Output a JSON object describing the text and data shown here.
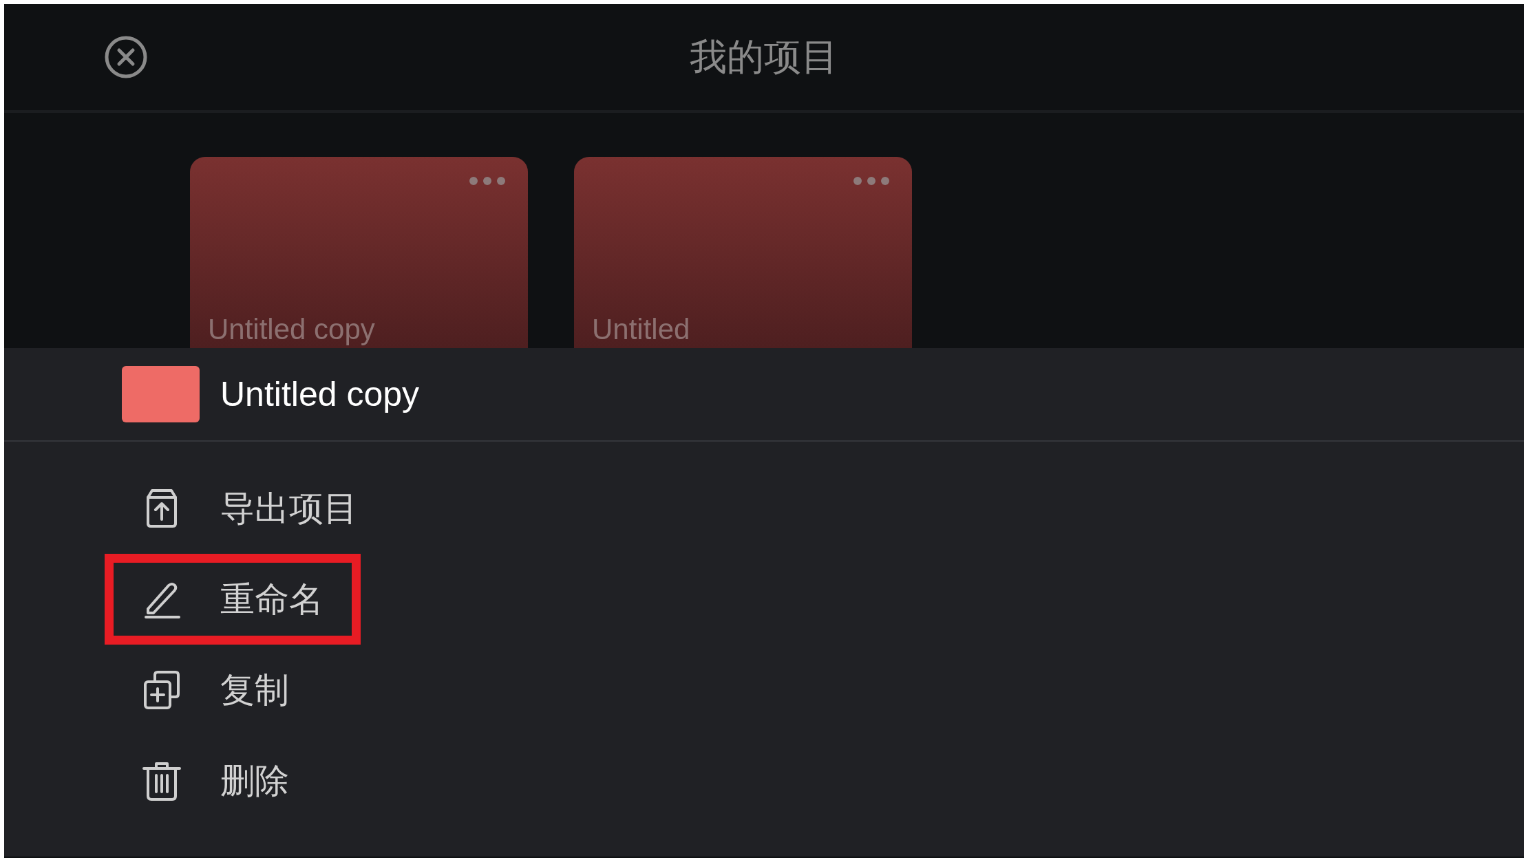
{
  "top_bar": {
    "title": "我的项目"
  },
  "projects": [
    {
      "name": "Untitled copy"
    },
    {
      "name": "Untitled"
    }
  ],
  "sheet": {
    "title": "Untitled copy",
    "color": "#ee6b66",
    "actions": [
      {
        "kind": "export",
        "label": "导出项目",
        "highlighted": false
      },
      {
        "kind": "rename",
        "label": "重命名",
        "highlighted": true
      },
      {
        "kind": "duplicate",
        "label": "复制",
        "highlighted": false
      },
      {
        "kind": "delete",
        "label": "删除",
        "highlighted": false
      }
    ]
  }
}
